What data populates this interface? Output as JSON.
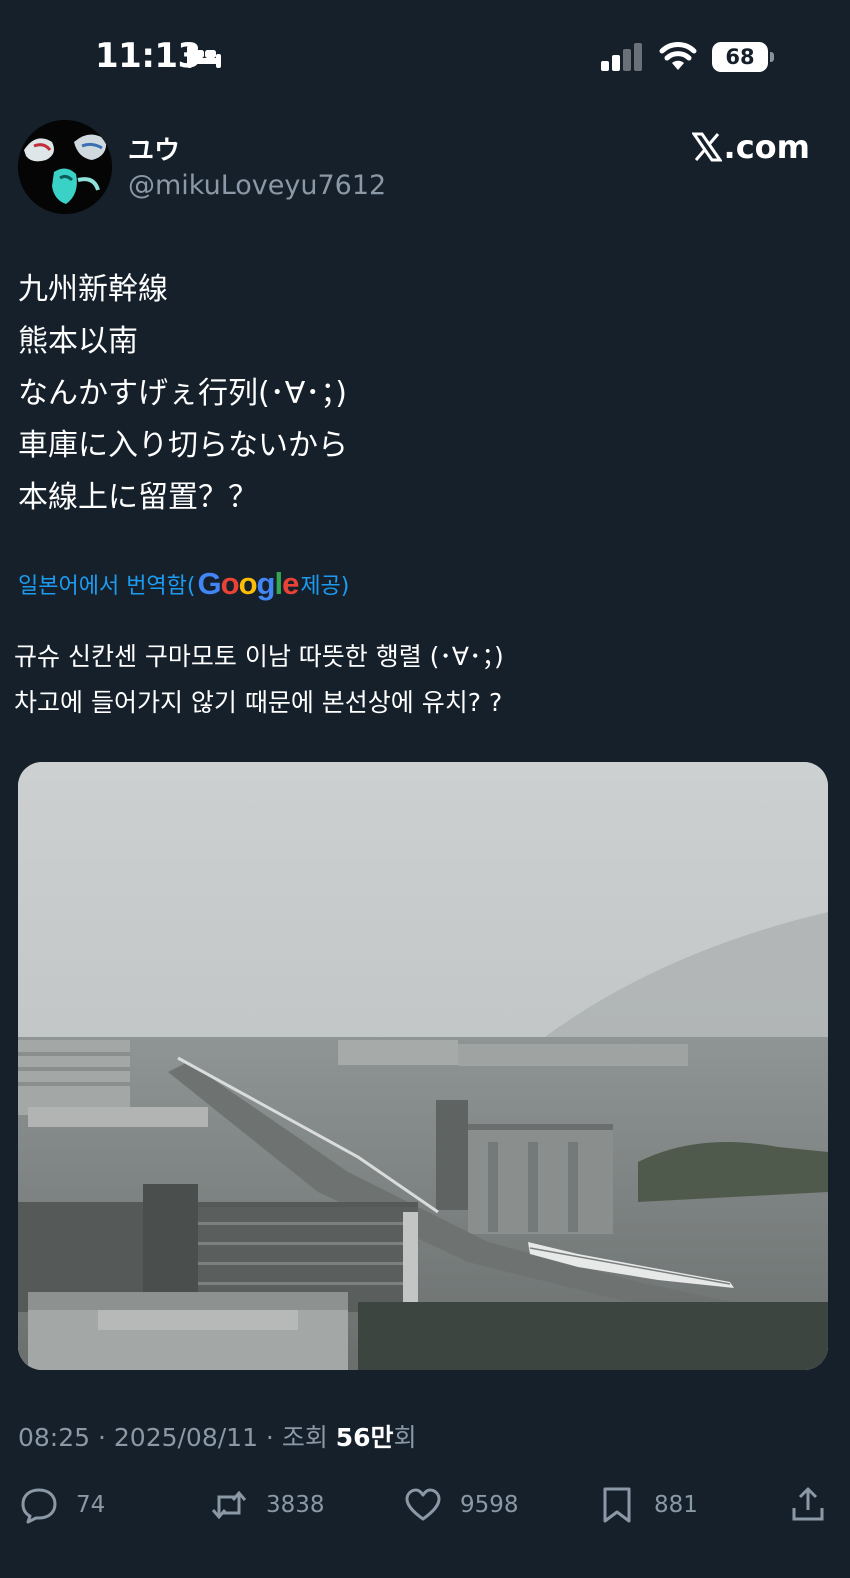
{
  "status_bar": {
    "time": "11:13",
    "battery_level": "68",
    "icons": [
      "sleep-focus-icon",
      "cellular-signal-icon",
      "wifi-icon",
      "battery-icon"
    ]
  },
  "post": {
    "display_name": "ユウ",
    "handle": "@mikuLoveyu7612",
    "site_label": ".com",
    "text_lines": [
      "九州新幹線",
      "熊本以南",
      "なんかすげぇ行列(･∀･；)",
      "車庫に入り切らないから",
      "本線上に留置？？"
    ],
    "translation": {
      "label_prefix": "일본어에서 번역함(",
      "provider": "Google",
      "label_suffix": " 제공)",
      "lines": [
        "규슈 신칸센 구마모토 이남 따뜻한 행렬 (･∀･；)",
        "차고에 들어가지 않기 때문에 본선상에 유치? ?"
      ]
    },
    "meta": {
      "timestamp": "08:25 · 2025/08/11 · 조회 ",
      "views_count": "56만",
      "views_suffix": "회"
    },
    "actions": {
      "replies": "74",
      "reposts": "3838",
      "likes": "9598",
      "bookmarks": "881"
    }
  },
  "colors": {
    "background": "#15202b",
    "secondary_text": "#8b98a5",
    "link": "#1d9bf0"
  }
}
